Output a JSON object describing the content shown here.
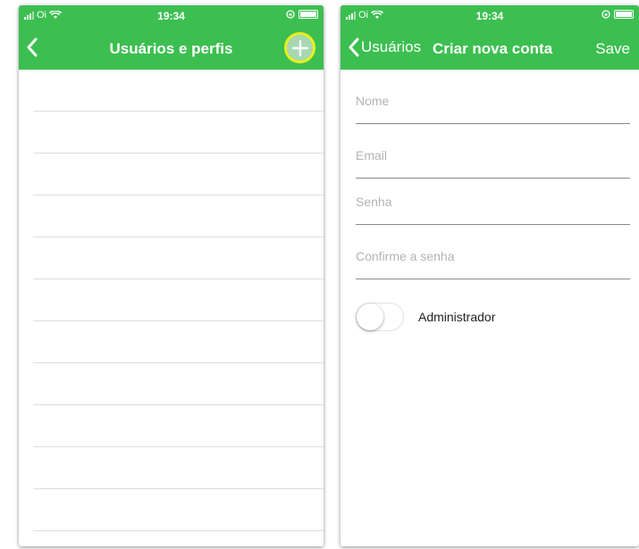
{
  "status_bar": {
    "carrier": "Oi",
    "time": "19:34"
  },
  "users_screen": {
    "title": "Usuários e perfis",
    "rows": [
      "",
      "",
      "",
      "",
      "",
      "",
      "",
      "",
      "",
      "",
      ""
    ]
  },
  "create_screen": {
    "back_label": "Usuários",
    "title": "Criar nova conta",
    "save_label": "Save",
    "fields": {
      "name_placeholder": "Nome",
      "email_placeholder": "Email",
      "password_placeholder": "Senha",
      "confirm_placeholder": "Confirme a senha"
    },
    "admin_toggle": {
      "label": "Administrador",
      "on": false
    }
  },
  "colors": {
    "accent": "#3cbf50",
    "highlight": "#e9ef1d"
  },
  "icons": [
    "signal-icon",
    "wifi-icon",
    "lock-rotation-icon",
    "battery-icon",
    "chevron-left-icon",
    "plus-icon"
  ]
}
